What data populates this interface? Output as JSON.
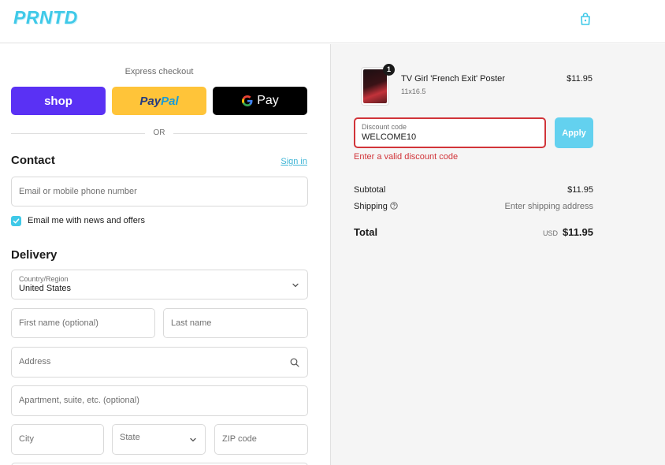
{
  "header": {
    "logo": "PRNTD",
    "cart_icon": "shopping-bag-icon"
  },
  "express": {
    "label": "Express checkout",
    "shop_label": "shop",
    "paypal_part1": "Pay",
    "paypal_part2": "Pal",
    "gpay_label": "Pay",
    "or_label": "OR"
  },
  "contact": {
    "title": "Contact",
    "sign_in": "Sign in",
    "email_placeholder": "Email or mobile phone number",
    "newsletter_checked": true,
    "newsletter_label": "Email me with news and offers"
  },
  "delivery": {
    "title": "Delivery",
    "country_label": "Country/Region",
    "country_value": "United States",
    "first_name_placeholder": "First name (optional)",
    "last_name_placeholder": "Last name",
    "address_placeholder": "Address",
    "apartment_placeholder": "Apartment, suite, etc. (optional)",
    "city_placeholder": "City",
    "state_placeholder": "State",
    "zip_placeholder": "ZIP code"
  },
  "order": {
    "item": {
      "name": "TV Girl 'French Exit' Poster",
      "variant": "11x16.5",
      "price": "$11.95",
      "quantity": "1"
    },
    "discount_label": "Discount code",
    "discount_value": "WELCOME10",
    "apply_label": "Apply",
    "error": "Enter a valid discount code",
    "subtotal_label": "Subtotal",
    "subtotal_value": "$11.95",
    "shipping_label": "Shipping",
    "shipping_value": "Enter shipping address",
    "total_label": "Total",
    "total_currency": "USD",
    "total_value": "$11.95"
  },
  "colors": {
    "accent": "#3fc9e8",
    "error": "#d13439",
    "shop": "#5a31f4",
    "paypal": "#ffc439"
  }
}
